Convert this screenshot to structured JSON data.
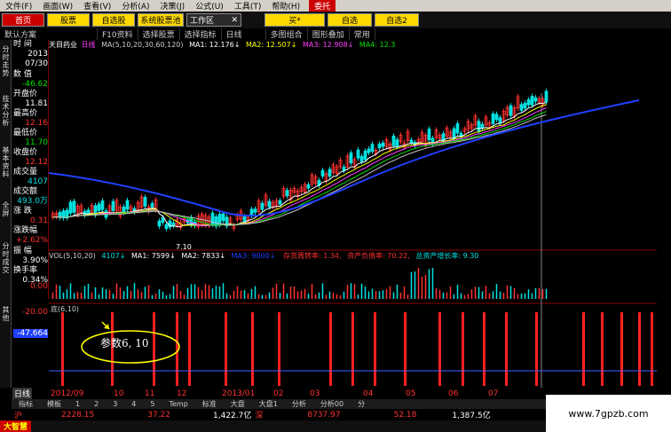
{
  "menu": [
    "文件(F)",
    "画面(W)",
    "查看(V)",
    "分析(A)",
    "决策(J)",
    "公式(U)",
    "工具(T)",
    "帮助(H)",
    "委托"
  ],
  "toolbar": {
    "home": "首页",
    "stocks": "股票",
    "self_select": "自选股",
    "compare": "系统股票池",
    "workspace": "工作区",
    "close": "✕",
    "buy": "买*",
    "self2": "自选",
    "self3": "自选2"
  },
  "toolbar2": [
    "默认方案",
    "F10资料",
    "选择股票",
    "选择指标",
    "日线",
    "多图组合",
    "图形叠加",
    "常用"
  ],
  "left_tabs": [
    "分时走势",
    "技术分析",
    "基本资料",
    "全屏",
    "分时成交",
    "其他"
  ],
  "info": [
    {
      "label": "时 间",
      "value": "2013",
      "value2": "07/30"
    },
    {
      "label": "数 值",
      "value": "-46.62"
    },
    {
      "label": "开盘价",
      "value": "11.81"
    },
    {
      "label": "最高价",
      "value": "12.16"
    },
    {
      "label": "最低价",
      "value": "11.70"
    },
    {
      "label": "收盘价",
      "value": "12.12"
    },
    {
      "label": "成交量",
      "value": "4107"
    },
    {
      "label": "成交额",
      "value": "493.0万"
    },
    {
      "label": "涨 跌",
      "value": "0.31"
    },
    {
      "label": "涨跌幅",
      "value": "+2.62%"
    },
    {
      "label": "振 幅",
      "value": "3.90%"
    },
    {
      "label": "换手率",
      "value": "0.34%"
    }
  ],
  "chart": {
    "stock_name": "天目药业",
    "period": "日线",
    "ma_label": "MA(5,10,20,30,60,120)",
    "ma1": "MA1: 12.176↓",
    "ma2": "MA2: 12.507↓",
    "ma3": "MA3: 12.908↓",
    "ma4": "MA4: 12.3",
    "low_mark": "7.10",
    "vol_legend": "VOL(5,10,20)",
    "vol": "4107↓",
    "vol_ma1": "MA1: 7599↓",
    "vol_ma2": "MA2: 7833↓",
    "vol_ma3": "MA3: 9000↓",
    "fin1": "存货周转率: 1.34,",
    "fin2": "资产负债率: 70.22,",
    "fin3": "总资产增长率: 9.30",
    "ind_legend": "底(6,10)",
    "ind_y1": "0.00",
    "ind_y2": "-20.00",
    "ind_y3": "-47.664",
    "annotation": "参数6, 10"
  },
  "axis_labels": [
    "日线",
    "2012/09",
    "10",
    "11",
    "12",
    "2013/01",
    "02",
    "03",
    "04",
    "05",
    "06",
    "07"
  ],
  "bottom_bar1": [
    "指标",
    "模板",
    "1",
    "2",
    "3",
    "4",
    "5",
    "Temp",
    "标准",
    "大盘",
    "大盘1",
    "分析",
    "分析00",
    "分"
  ],
  "status": {
    "sh_label": "沪",
    "sh_val": "2228.15",
    "sh_chg": "37.22",
    "sh_vol": "1,422.7亿",
    "sz_label": "深",
    "sz_val": "8737.97",
    "sz_chg": "52.18",
    "sz_vol": "1,387.5亿"
  },
  "taskbar": {
    "app": "大智慧"
  },
  "watermark": "www.7gpzb.com",
  "colors": {
    "red": "#ff3030",
    "green": "#00e000",
    "cyan": "#00e0e0",
    "yellow": "#ffff00",
    "blue": "#2040ff",
    "magenta": "#ff40ff",
    "white": "#f0f0f0"
  }
}
